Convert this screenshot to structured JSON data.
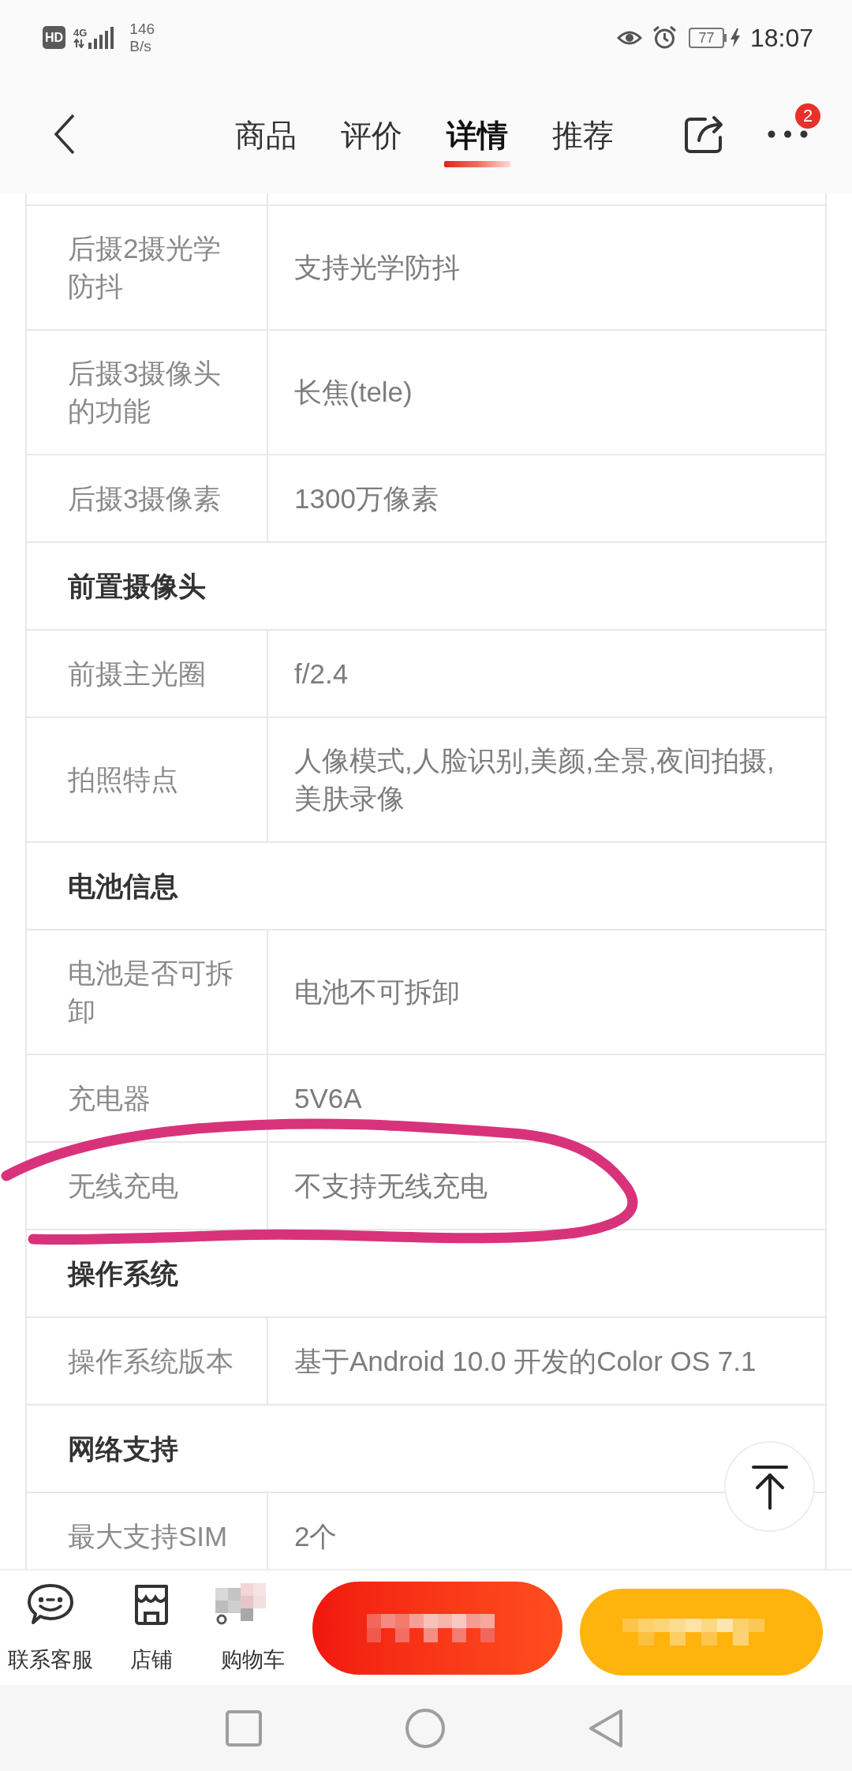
{
  "status_bar": {
    "hd": "HD",
    "network": "4G",
    "speed": "146",
    "speed_unit": "B/s",
    "battery": "77",
    "time": "18:07"
  },
  "header": {
    "tabs": [
      {
        "label": "商品",
        "selected": false
      },
      {
        "label": "评价",
        "selected": false
      },
      {
        "label": "详情",
        "selected": true
      },
      {
        "label": "推荐",
        "selected": false
      }
    ],
    "more_badge": "2"
  },
  "spec_table": {
    "rows": [
      {
        "kind": "spec",
        "label": "后摄2摄光学防抖",
        "value": "支持光学防抖"
      },
      {
        "kind": "spec",
        "label": "后摄3摄像头的功能",
        "value": "长焦(tele)"
      },
      {
        "kind": "spec",
        "label": "后摄3摄像素",
        "value": "1300万像素"
      },
      {
        "kind": "section",
        "label": "前置摄像头"
      },
      {
        "kind": "spec",
        "label": "前摄主光圈",
        "value": "f/2.4"
      },
      {
        "kind": "spec",
        "label": "拍照特点",
        "value": "人像模式,人脸识别,美颜,全景,夜间拍摄,美肤录像"
      },
      {
        "kind": "section",
        "label": "电池信息"
      },
      {
        "kind": "spec",
        "label": "电池是否可拆卸",
        "value": "电池不可拆卸"
      },
      {
        "kind": "spec",
        "label": "充电器",
        "value": "5V6A"
      },
      {
        "kind": "spec",
        "label": "无线充电",
        "value": "不支持无线充电"
      },
      {
        "kind": "section",
        "label": "操作系统"
      },
      {
        "kind": "spec",
        "label": "操作系统版本",
        "value": "基于Android 10.0 开发的Color OS 7.1"
      },
      {
        "kind": "section",
        "label": "网络支持"
      },
      {
        "kind": "spec",
        "label": "最大支持SIM",
        "value": "2个"
      }
    ]
  },
  "bottom_bar": {
    "actions": [
      {
        "kind": "service",
        "label": "联系客服"
      },
      {
        "kind": "store",
        "label": "店铺"
      },
      {
        "kind": "cart",
        "label": "购物车"
      }
    ],
    "buttons": [
      {
        "kind": "primary"
      },
      {
        "kind": "secondary"
      }
    ]
  }
}
